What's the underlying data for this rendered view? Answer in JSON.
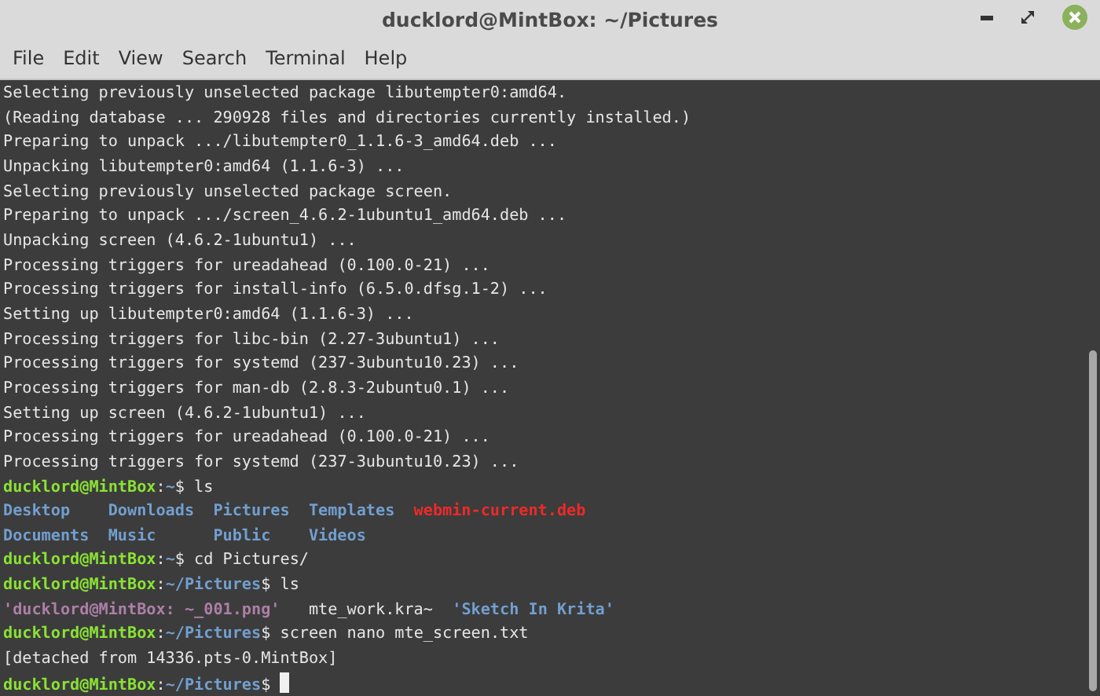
{
  "window": {
    "title": "ducklord@MintBox: ~/Pictures"
  },
  "menu": [
    "File",
    "Edit",
    "View",
    "Search",
    "Terminal",
    "Help"
  ],
  "terminal": {
    "cursor_visible": true,
    "lines": [
      {
        "segments": [
          {
            "kind": "plain",
            "text": "Selecting previously unselected package libutempter0:amd64."
          }
        ]
      },
      {
        "segments": [
          {
            "kind": "plain",
            "text": "(Reading database ... 290928 files and directories currently installed.)"
          }
        ]
      },
      {
        "segments": [
          {
            "kind": "plain",
            "text": "Preparing to unpack .../libutempter0_1.1.6-3_amd64.deb ..."
          }
        ]
      },
      {
        "segments": [
          {
            "kind": "plain",
            "text": "Unpacking libutempter0:amd64 (1.1.6-3) ..."
          }
        ]
      },
      {
        "segments": [
          {
            "kind": "plain",
            "text": "Selecting previously unselected package screen."
          }
        ]
      },
      {
        "segments": [
          {
            "kind": "plain",
            "text": "Preparing to unpack .../screen_4.6.2-1ubuntu1_amd64.deb ..."
          }
        ]
      },
      {
        "segments": [
          {
            "kind": "plain",
            "text": "Unpacking screen (4.6.2-1ubuntu1) ..."
          }
        ]
      },
      {
        "segments": [
          {
            "kind": "plain",
            "text": "Processing triggers for ureadahead (0.100.0-21) ..."
          }
        ]
      },
      {
        "segments": [
          {
            "kind": "plain",
            "text": "Processing triggers for install-info (6.5.0.dfsg.1-2) ..."
          }
        ]
      },
      {
        "segments": [
          {
            "kind": "plain",
            "text": "Setting up libutempter0:amd64 (1.1.6-3) ..."
          }
        ]
      },
      {
        "segments": [
          {
            "kind": "plain",
            "text": "Processing triggers for libc-bin (2.27-3ubuntu1) ..."
          }
        ]
      },
      {
        "segments": [
          {
            "kind": "plain",
            "text": "Processing triggers for systemd (237-3ubuntu10.23) ..."
          }
        ]
      },
      {
        "segments": [
          {
            "kind": "plain",
            "text": "Processing triggers for man-db (2.8.3-2ubuntu0.1) ..."
          }
        ]
      },
      {
        "segments": [
          {
            "kind": "plain",
            "text": "Setting up screen (4.6.2-1ubuntu1) ..."
          }
        ]
      },
      {
        "segments": [
          {
            "kind": "plain",
            "text": "Processing triggers for ureadahead (0.100.0-21) ..."
          }
        ]
      },
      {
        "segments": [
          {
            "kind": "plain",
            "text": "Processing triggers for systemd (237-3ubuntu10.23) ..."
          }
        ]
      },
      {
        "segments": [
          {
            "kind": "user",
            "text": "ducklord@MintBox"
          },
          {
            "kind": "plain",
            "text": ":"
          },
          {
            "kind": "path",
            "text": "~"
          },
          {
            "kind": "plain",
            "text": "$ ls"
          }
        ]
      },
      {
        "kind": "columns",
        "segments": [
          {
            "kind": "dir",
            "text": "Desktop"
          },
          {
            "kind": "dir",
            "text": "Downloads"
          },
          {
            "kind": "dir",
            "text": "Pictures"
          },
          {
            "kind": "dir",
            "text": "Templates"
          },
          {
            "kind": "archive",
            "text": "webmin-current.deb"
          }
        ]
      },
      {
        "kind": "columns",
        "segments": [
          {
            "kind": "dir",
            "text": "Documents"
          },
          {
            "kind": "dir",
            "text": "Music"
          },
          {
            "kind": "dir",
            "text": "Public"
          },
          {
            "kind": "dir",
            "text": "Videos"
          }
        ]
      },
      {
        "segments": [
          {
            "kind": "user",
            "text": "ducklord@MintBox"
          },
          {
            "kind": "plain",
            "text": ":"
          },
          {
            "kind": "path",
            "text": "~"
          },
          {
            "kind": "plain",
            "text": "$ cd Pictures/"
          }
        ]
      },
      {
        "segments": [
          {
            "kind": "user",
            "text": "ducklord@MintBox"
          },
          {
            "kind": "plain",
            "text": ":"
          },
          {
            "kind": "path",
            "text": "~/Pictures"
          },
          {
            "kind": "plain",
            "text": "$ ls"
          }
        ]
      },
      {
        "segments": [
          {
            "kind": "image",
            "text": "'ducklord@MintBox: ~_001.png'"
          },
          {
            "kind": "plain",
            "text": "   mte_work.kra~  "
          },
          {
            "kind": "dir",
            "text": "'Sketch In Krita'"
          }
        ]
      },
      {
        "segments": [
          {
            "kind": "user",
            "text": "ducklord@MintBox"
          },
          {
            "kind": "plain",
            "text": ":"
          },
          {
            "kind": "path",
            "text": "~/Pictures"
          },
          {
            "kind": "plain",
            "text": "$ screen nano mte_screen.txt"
          }
        ]
      },
      {
        "segments": [
          {
            "kind": "plain",
            "text": "[detached from 14336.pts-0.MintBox]"
          }
        ]
      },
      {
        "segments": [
          {
            "kind": "user",
            "text": "ducklord@MintBox"
          },
          {
            "kind": "plain",
            "text": ":"
          },
          {
            "kind": "path",
            "text": "~/Pictures"
          },
          {
            "kind": "plain",
            "text": "$ "
          }
        ]
      }
    ]
  }
}
